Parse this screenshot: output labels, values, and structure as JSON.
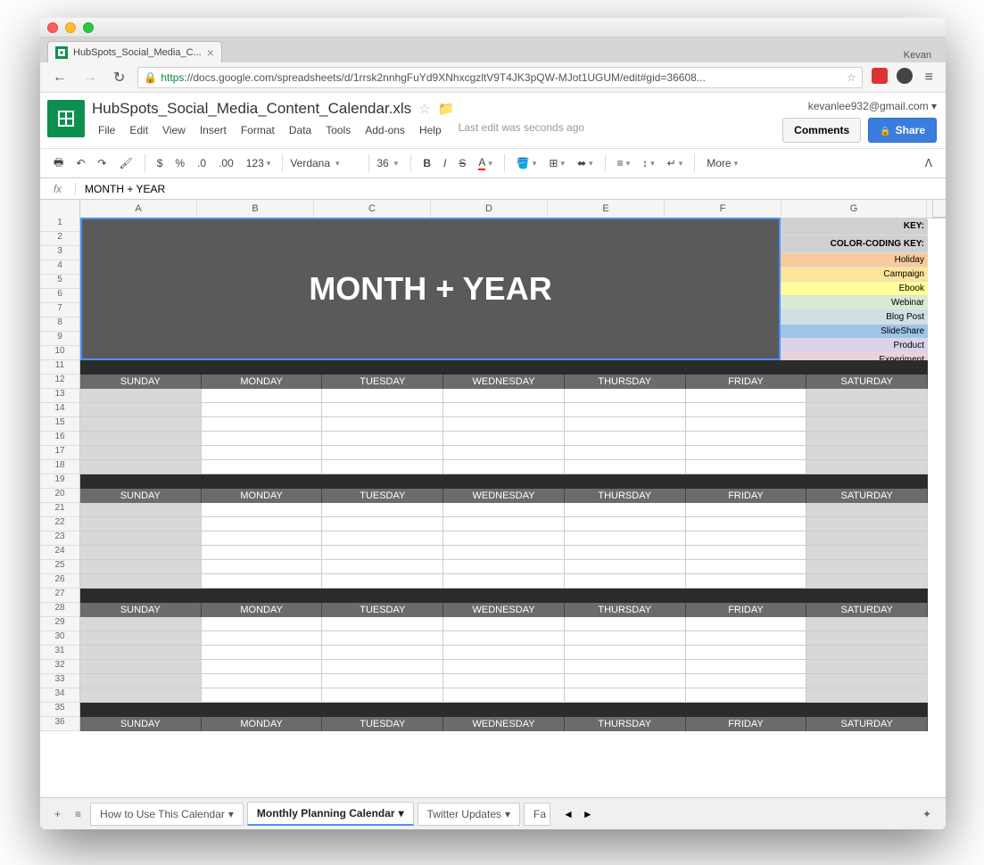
{
  "browser": {
    "tab_title": "HubSpots_Social_Media_C...",
    "user_name": "Kevan",
    "url_https": "https",
    "url_domain": "://docs.google.com",
    "url_path": "/spreadsheets/d/1rrsk2nnhgFuYd9XNhxcgzltV9T4JK3pQW-MJot1UGUM/edit#gid=36608..."
  },
  "docs": {
    "title": "HubSpots_Social_Media_Content_Calendar.xls",
    "user_email": "kevanlee932@gmail.com",
    "menus": [
      "File",
      "Edit",
      "View",
      "Insert",
      "Format",
      "Data",
      "Tools",
      "Add-ons",
      "Help"
    ],
    "last_edit": "Last edit was seconds ago",
    "comments_btn": "Comments",
    "share_btn": "Share"
  },
  "toolbar": {
    "font": "Verdana",
    "size": "36",
    "more": "More"
  },
  "formula": {
    "fx": "fx",
    "value": "MONTH + YEAR"
  },
  "columns": [
    "A",
    "B",
    "C",
    "D",
    "E",
    "F",
    "G"
  ],
  "merged_title": "MONTH + YEAR",
  "key": {
    "header1": "KEY:",
    "header2": "COLOR-CODING KEY:",
    "items": [
      {
        "label": "Holiday",
        "class": "k-holiday"
      },
      {
        "label": "Campaign",
        "class": "k-campaign"
      },
      {
        "label": "Ebook",
        "class": "k-ebook"
      },
      {
        "label": "Webinar",
        "class": "k-webinar"
      },
      {
        "label": "Blog Post",
        "class": "k-blogpost"
      },
      {
        "label": "SlideShare",
        "class": "k-slideshare"
      },
      {
        "label": "Product",
        "class": "k-product"
      },
      {
        "label": "Experiment",
        "class": "k-experiment"
      }
    ]
  },
  "days": [
    "SUNDAY",
    "MONDAY",
    "TUESDAY",
    "WEDNESDAY",
    "THURSDAY",
    "FRIDAY",
    "SATURDAY"
  ],
  "sheet_tabs": {
    "tab1": "How to Use This Calendar",
    "tab2": "Monthly Planning Calendar",
    "tab3": "Twitter Updates",
    "tab4": "Fa"
  }
}
